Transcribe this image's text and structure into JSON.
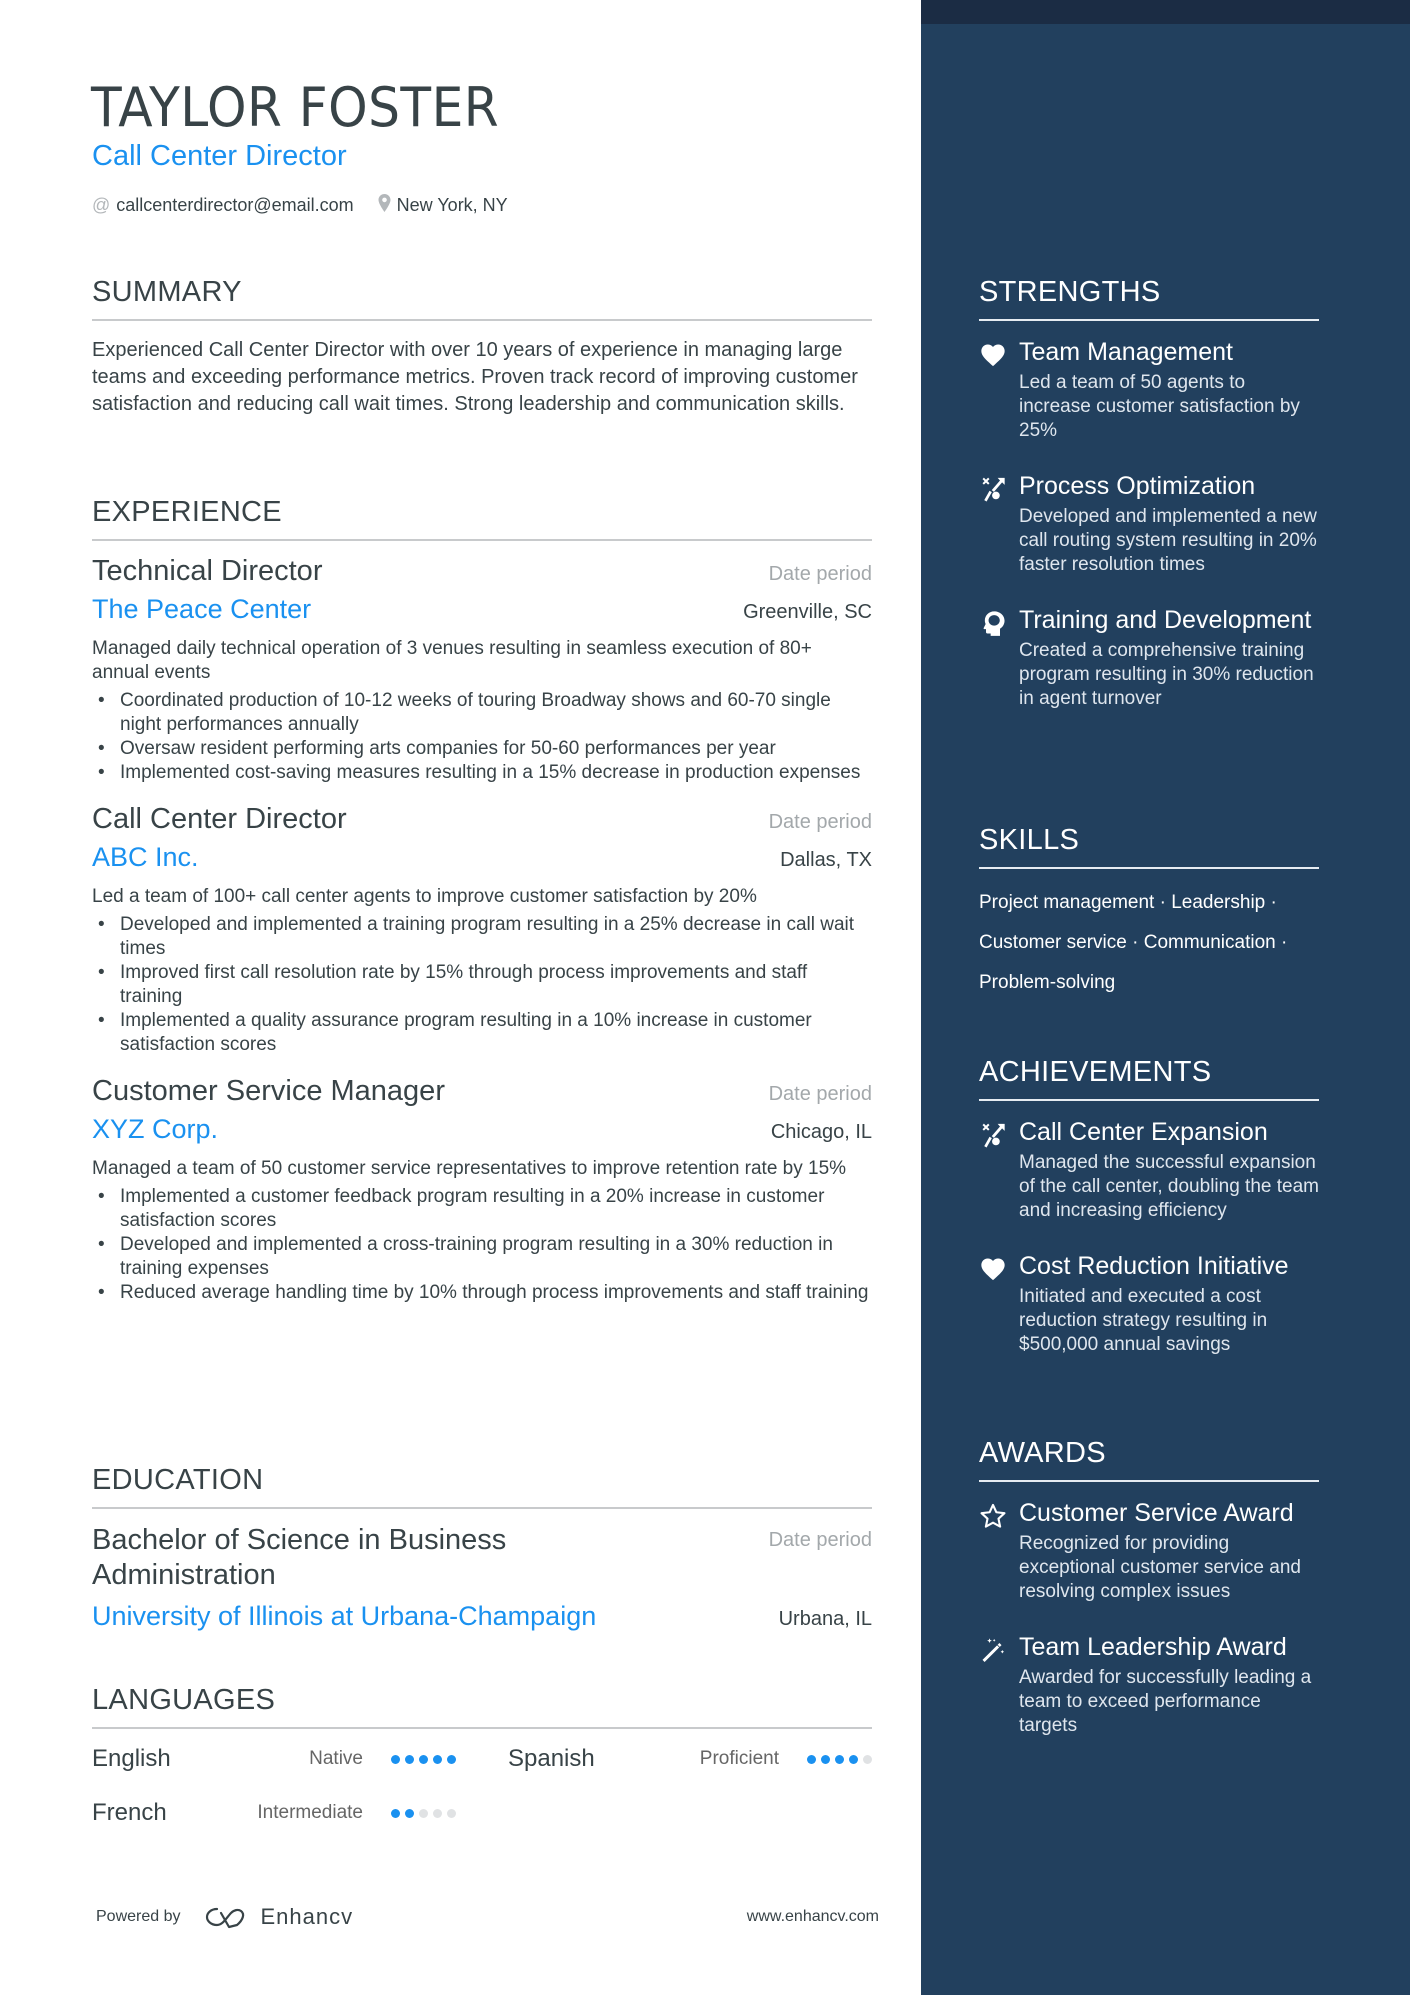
{
  "header": {
    "name": "TAYLOR FOSTER",
    "title": "Call Center Director",
    "email": "callcenterdirector@email.com",
    "location": "New York, NY",
    "email_icon": "at-icon",
    "location_icon": "map-pin-icon"
  },
  "summary": {
    "title": "SUMMARY",
    "text": "Experienced Call Center Director with over 10 years of experience in managing large teams and exceeding performance metrics. Proven track record of improving customer satisfaction and reducing call wait times. Strong leadership and communication skills."
  },
  "experience": {
    "title": "EXPERIENCE",
    "jobs": [
      {
        "title": "Technical Director",
        "date": "Date period",
        "company": "The Peace Center",
        "location": "Greenville, SC",
        "description": "Managed daily technical operation of 3 venues resulting in seamless execution of 80+ annual events",
        "bullets": [
          "Coordinated production of 10-12 weeks of touring Broadway shows and 60-70 single night performances annually",
          "Oversaw resident performing arts companies for 50-60 performances per year",
          "Implemented cost-saving measures resulting in a 15% decrease in production expenses"
        ]
      },
      {
        "title": "Call Center Director",
        "date": "Date period",
        "company": "ABC Inc.",
        "location": "Dallas, TX",
        "description": "Led a team of 100+ call center agents to improve customer satisfaction by 20%",
        "bullets": [
          "Developed and implemented a training program resulting in a 25% decrease in call wait times",
          "Improved first call resolution rate by 15% through process improvements and staff training",
          "Implemented a quality assurance program resulting in a 10% increase in customer satisfaction scores"
        ]
      },
      {
        "title": "Customer Service Manager",
        "date": "Date period",
        "company": "XYZ Corp.",
        "location": "Chicago, IL",
        "description": "Managed a team of 50 customer service representatives to improve retention rate by 15%",
        "bullets": [
          "Implemented a customer feedback program resulting in a 20% increase in customer satisfaction scores",
          "Developed and implemented a cross-training program resulting in a 30% reduction in training expenses",
          "Reduced average handling time by 10% through process improvements and staff training"
        ]
      }
    ]
  },
  "education": {
    "title": "EDUCATION",
    "degree": "Bachelor of Science in Business Administration",
    "date": "Date period",
    "school": "University of Illinois at Urbana-Champaign",
    "location": "Urbana, IL"
  },
  "languages": {
    "title": "LANGUAGES",
    "items": [
      {
        "name": "English",
        "level": "Native",
        "rating": 5,
        "max": 5
      },
      {
        "name": "Spanish",
        "level": "Proficient",
        "rating": 4,
        "max": 5
      },
      {
        "name": "French",
        "level": "Intermediate",
        "rating": 2,
        "max": 5
      }
    ]
  },
  "footer": {
    "powered_by": "Powered by",
    "brand": "Enhancv",
    "website": "www.enhancv.com"
  },
  "strengths": {
    "title": "STRENGTHS",
    "items": [
      {
        "icon": "heart-icon",
        "title": "Team Management",
        "desc": "Led a team of 50 agents to increase customer satisfaction by 25%"
      },
      {
        "icon": "strategy-icon",
        "title": "Process Optimization",
        "desc": "Developed and implemented a new call routing system resulting in 20% faster resolution times"
      },
      {
        "icon": "head-icon",
        "title": "Training and Development",
        "desc": "Created a comprehensive training program resulting in 30% reduction in agent turnover"
      }
    ]
  },
  "skills": {
    "title": "SKILLS",
    "items": [
      "Project management",
      "Leadership",
      "Customer service",
      "Communication",
      "Problem-solving"
    ]
  },
  "achievements": {
    "title": "ACHIEVEMENTS",
    "items": [
      {
        "icon": "strategy-icon",
        "title": "Call Center Expansion",
        "desc": "Managed the successful expansion of the call center, doubling the team and increasing efficiency"
      },
      {
        "icon": "heart-icon",
        "title": "Cost Reduction Initiative",
        "desc": "Initiated and executed a cost reduction strategy resulting in $500,000 annual savings"
      }
    ]
  },
  "awards": {
    "title": "AWARDS",
    "items": [
      {
        "icon": "star-icon",
        "title": "Customer Service Award",
        "desc": "Recognized for providing exceptional customer service and resolving complex issues"
      },
      {
        "icon": "magic-wand-icon",
        "title": "Team Leadership Award",
        "desc": "Awarded for successfully leading a team to exceed performance targets"
      }
    ]
  },
  "colors": {
    "accent": "#1a91f0",
    "sidebar": "#22405e",
    "sidebar_top": "#1b2c44",
    "text": "#384347"
  }
}
